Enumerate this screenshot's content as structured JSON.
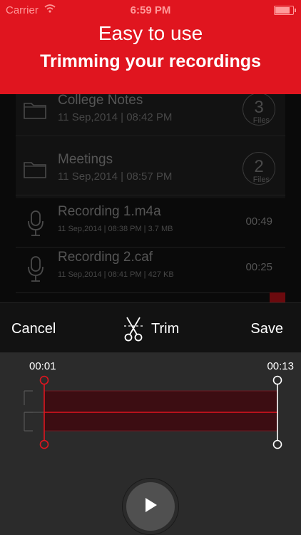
{
  "status_bar": {
    "carrier": "Carrier",
    "wifi_icon": "wifi-icon",
    "time": "6:59 PM",
    "battery_icon": "battery-icon"
  },
  "promo": {
    "headline": "Easy to use",
    "subheadline": "Trimming your recordings"
  },
  "list": {
    "folders": [
      {
        "name": "College Notes",
        "date": "11 Sep,2014 | 08:42 PM",
        "count": "3",
        "count_label": "Files",
        "icon": "folder-icon"
      },
      {
        "name": "Meetings",
        "date": "11 Sep,2014 | 08:57 PM",
        "count": "2",
        "count_label": "Files",
        "icon": "folder-icon"
      }
    ],
    "recordings": [
      {
        "name": "Recording 1.m4a",
        "meta": "11 Sep,2014 | 08:38 PM | 3.7 MB",
        "duration": "00:49",
        "icon": "microphone-icon"
      },
      {
        "name": "Recording 2.caf",
        "meta": "11 Sep,2014 | 08:41 PM | 427 KB",
        "duration": "00:25",
        "icon": "microphone-icon"
      }
    ]
  },
  "toolbar": {
    "cancel_label": "Cancel",
    "trim_label": "Trim",
    "trim_icon": "scissors-icon",
    "save_label": "Save"
  },
  "editor": {
    "start_time": "00:01",
    "end_time": "00:13",
    "play_icon": "play-icon",
    "colors": {
      "accent": "#e0151f",
      "selection": "#3c0d12"
    }
  }
}
